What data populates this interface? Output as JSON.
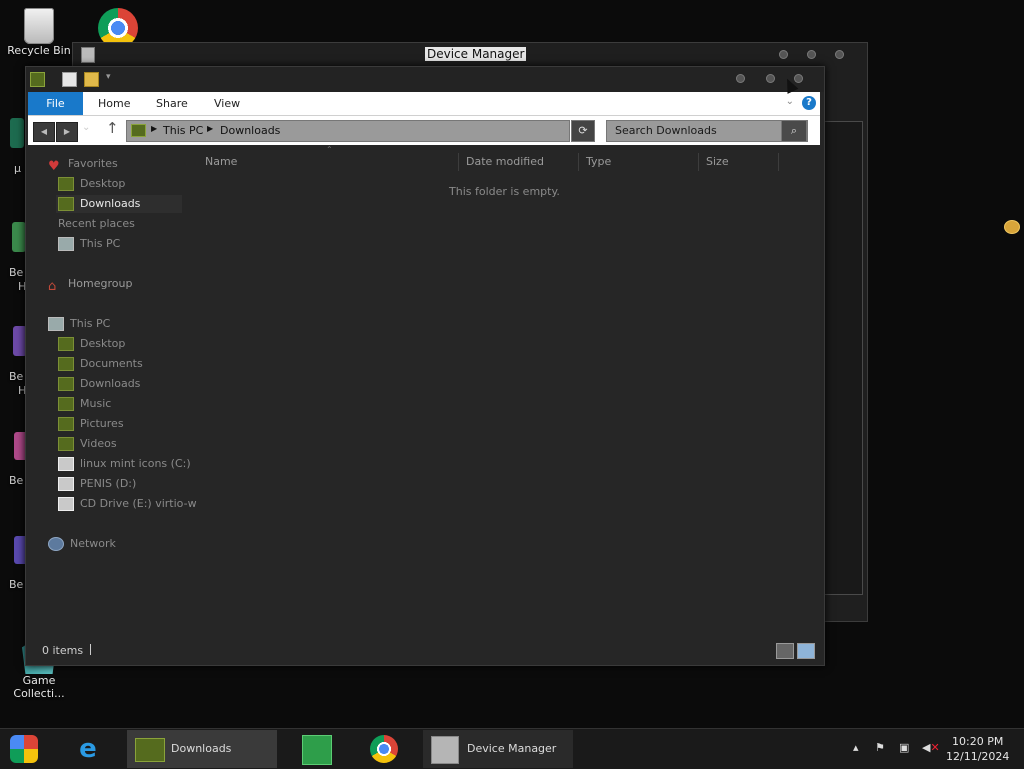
{
  "desktop": {
    "recycle_bin_label": "Recycle Bin",
    "stub_labels": [
      "µ",
      "Be",
      "H",
      "Be",
      "H",
      "Be",
      "Be"
    ],
    "game_label_1": "Game",
    "game_label_2": "Collecti..."
  },
  "device_manager": {
    "title": "Device Manager"
  },
  "explorer": {
    "ribbon_tabs": {
      "file": "File",
      "home": "Home",
      "share": "Share",
      "view": "View"
    },
    "breadcrumb": {
      "root": "This PC",
      "current": "Downloads"
    },
    "search_placeholder": "Search Downloads",
    "nav": {
      "favorites": "Favorites",
      "fav_desktop": "Desktop",
      "fav_downloads": "Downloads",
      "fav_recent": "Recent places",
      "fav_thispc": "This PC",
      "homegroup": "Homegroup",
      "thispc": "This PC",
      "pc_desktop": "Desktop",
      "pc_documents": "Documents",
      "pc_downloads": "Downloads",
      "pc_music": "Music",
      "pc_pictures": "Pictures",
      "pc_videos": "Videos",
      "drive_c": "linux mint icons (C:)",
      "drive_d": "PENIS (D:)",
      "drive_e": "CD Drive (E:) virtio-w",
      "network": "Network"
    },
    "columns": {
      "name": "Name",
      "date_modified": "Date modified",
      "type": "Type",
      "size": "Size"
    },
    "empty_message": "This folder is empty.",
    "status_items": "0 items"
  },
  "taskbar": {
    "downloads_label": "Downloads",
    "device_manager_label": "Device Manager",
    "time": "10:20 PM",
    "date": "12/11/2024"
  },
  "colors": {
    "accent": "#1979ca",
    "folder_green": "#556b1e"
  }
}
